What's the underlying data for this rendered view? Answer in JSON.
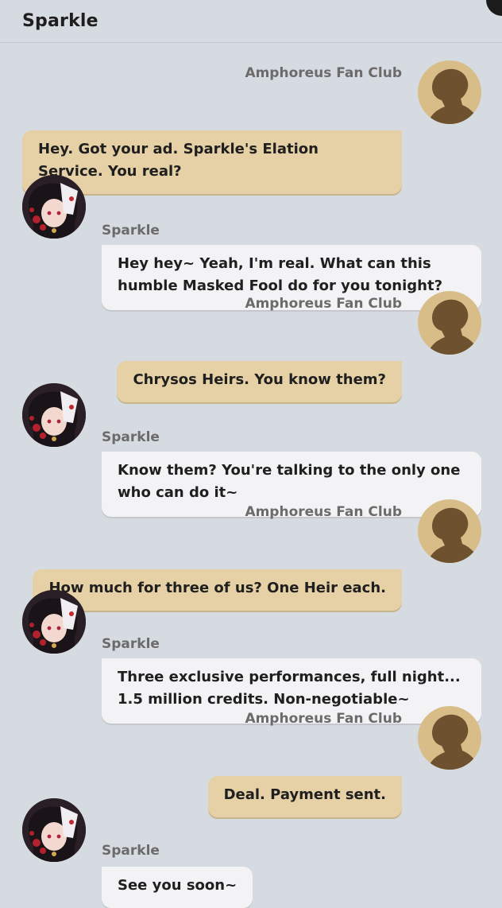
{
  "header": {
    "title": "Sparkle"
  },
  "colors": {
    "background": "#d6dbe1",
    "outgoing_bubble": "#e6d0a6",
    "incoming_bubble": "#f3f3f5",
    "placeholder_avatar": "#d9bd88",
    "silhouette": "#6e5230"
  },
  "messages": [
    {
      "direction": "outgoing",
      "sender": "Amphoreus Fan Club",
      "avatar_icon": "silhouette-avatar-icon",
      "text": "Hey. Got your ad. Sparkle's Elation\nService. You real?"
    },
    {
      "direction": "incoming",
      "sender": "Sparkle",
      "avatar_icon": "sparkle-avatar-icon",
      "text": "Hey hey~ Yeah, I'm real. What can this\nhumble Masked Fool do for you tonight?"
    },
    {
      "direction": "outgoing",
      "sender": "Amphoreus Fan Club",
      "avatar_icon": "silhouette-avatar-icon",
      "text": "Chrysos Heirs. You know them?"
    },
    {
      "direction": "incoming",
      "sender": "Sparkle",
      "avatar_icon": "sparkle-avatar-icon",
      "text": "Know them? You're talking to the only one\nwho can do it~"
    },
    {
      "direction": "outgoing",
      "sender": "Amphoreus Fan Club",
      "avatar_icon": "silhouette-avatar-icon",
      "text": "How much for three of us? One Heir each."
    },
    {
      "direction": "incoming",
      "sender": "Sparkle",
      "avatar_icon": "sparkle-avatar-icon",
      "text": "Three exclusive performances, full night...\n1.5 million credits. Non-negotiable~"
    },
    {
      "direction": "outgoing",
      "sender": "Amphoreus Fan Club",
      "avatar_icon": "silhouette-avatar-icon",
      "text": "Deal. Payment sent."
    },
    {
      "direction": "incoming",
      "sender": "Sparkle",
      "avatar_icon": "sparkle-avatar-icon",
      "text": "See you soon~"
    }
  ]
}
